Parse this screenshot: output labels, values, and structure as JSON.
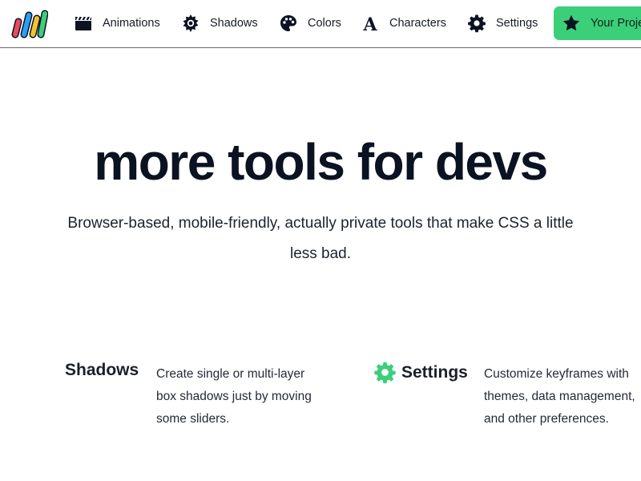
{
  "nav": {
    "logo_icon": "bar-logo-icon",
    "items": [
      {
        "label": "Animations",
        "icon": "clapperboard-icon"
      },
      {
        "label": "Shadows",
        "icon": "sun-gear-icon"
      },
      {
        "label": "Colors",
        "icon": "palette-icon"
      },
      {
        "label": "Characters",
        "icon": "letter-a-icon"
      },
      {
        "label": "Settings",
        "icon": "gear-icon"
      }
    ],
    "project": {
      "label": "Your Projects",
      "icon": "star-icon",
      "color": "#3ccf7a"
    }
  },
  "hero": {
    "title": "more tools for devs",
    "subtitle": "Browser-based, mobile-friendly, actually private tools that make CSS a little less bad."
  },
  "features": [
    {
      "title": "Shadows",
      "description": "Create single or multi-layer box shadows just by moving some sliders."
    },
    {
      "title": "Settings",
      "icon": "gear-icon",
      "icon_color": "#3ccf7a",
      "description": "Customize keyframes with themes, data management, and other preferences."
    }
  ],
  "colors": {
    "accent": "#3ccf7a",
    "logo": [
      "#e84a5f",
      "#2aa1f2",
      "#f2c230",
      "#3ccf7a"
    ]
  }
}
